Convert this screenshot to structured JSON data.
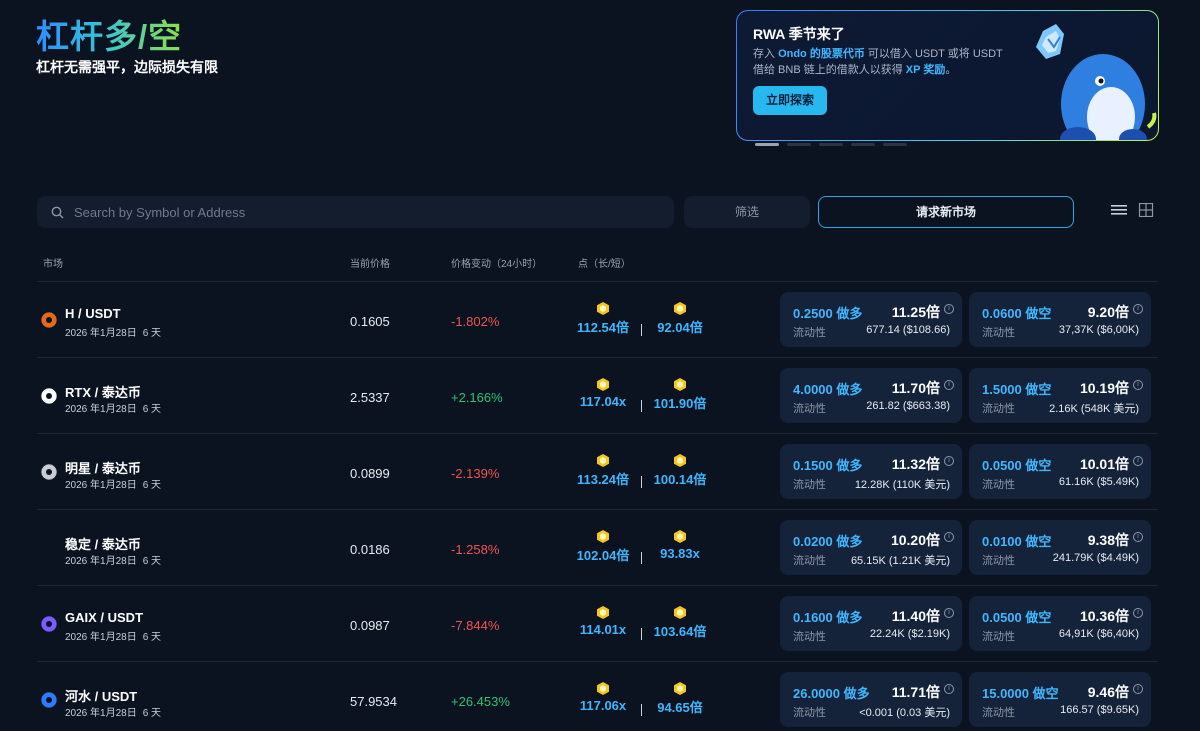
{
  "hero": {
    "title": "杠杆多/空",
    "subtitle": "杠杆无需强平，边际损失有限"
  },
  "promo": {
    "title": "RWA 季节来了",
    "line1_a": "存入 ",
    "line1_hl": "Ondo 的股票代币",
    "line1_b": " 可以借入 USDT 或将 USDT",
    "line2_a": "借给 BNB 链上的借款人以获得 ",
    "line2_hl": "XP 奖励",
    "line2_b": "。",
    "button": "立即探索"
  },
  "toolbar": {
    "search_placeholder": "Search by Symbol or Address",
    "filter": "筛选",
    "request": "请求新市场"
  },
  "table": {
    "headers": {
      "market": "市场",
      "price": "当前价格",
      "change": "价格变动（24小时）",
      "points": "点（长/短）"
    },
    "liq_label": "流动性",
    "days": "6 天",
    "rows": [
      {
        "pair": "H / USDT",
        "date": "2026 年1月28日",
        "price": "0.1605",
        "change": "-1.802%",
        "dir": "neg",
        "pts_long": "112.54倍",
        "pts_short": "92.04倍",
        "long": {
          "rate": "0.2500 做多",
          "lev": "11.25倍",
          "liq": "677.14 ($108.66)"
        },
        "short": {
          "rate": "0.0600 做空",
          "lev": "9.20倍",
          "liq": "37,37K ($6,00K)"
        },
        "icon_color": "#e36a1c"
      },
      {
        "pair": "RTX / 泰达币",
        "date": "2026 年1月28日",
        "price": "2.5337",
        "change": "+2.166%",
        "dir": "pos",
        "pts_long": "117.04x",
        "pts_short": "101.90倍",
        "long": {
          "rate": "4.0000 做多",
          "lev": "11.70倍",
          "liq": "261.82 ($663.38)"
        },
        "short": {
          "rate": "1.5000 做空",
          "lev": "10.19倍",
          "liq": "2.16K (548K 美元)"
        },
        "icon_color": "#ffffff"
      },
      {
        "pair": "明星 / 泰达币",
        "date": "2026 年1月28日",
        "price": "0.0899",
        "change": "-2.139%",
        "dir": "neg",
        "pts_long": "113.24倍",
        "pts_short": "100.14倍",
        "long": {
          "rate": "0.1500 做多",
          "lev": "11.32倍",
          "liq": "12.28K (110K 美元)"
        },
        "short": {
          "rate": "0.0500 做空",
          "lev": "10.01倍",
          "liq": "61.16K ($5.49K)"
        },
        "icon_color": "#c9ccd2"
      },
      {
        "pair": "稳定 / 泰达币",
        "date": "2026 年1月28日",
        "price": "0.0186",
        "change": "-1.258%",
        "dir": "neg",
        "pts_long": "102.04倍",
        "pts_short": "93.83x",
        "long": {
          "rate": "0.0200 做多",
          "lev": "10.20倍",
          "liq": "65.15K (1.21K 美元)"
        },
        "short": {
          "rate": "0.0100 做空",
          "lev": "9.38倍",
          "liq": "241.79K ($4.49K)"
        },
        "icon_color": "#0b1220"
      },
      {
        "pair": "GAIX / USDT",
        "date": "2026 年1月28日",
        "price": "0.0987",
        "change": "-7.844%",
        "dir": "neg",
        "pts_long": "114.01x",
        "pts_short": "103.64倍",
        "long": {
          "rate": "0.1600 做多",
          "lev": "11.40倍",
          "liq": "22.24K ($2.19K)"
        },
        "short": {
          "rate": "0.0500 做空",
          "lev": "10.36倍",
          "liq": "64,91K ($6,40K)"
        },
        "icon_color": "#7b5cff"
      },
      {
        "pair": "河水 / USDT",
        "date": "2026 年1月28日",
        "price": "57.9534",
        "change": "+26.453%",
        "dir": "pos",
        "pts_long": "117.06x",
        "pts_short": "94.65倍",
        "long": {
          "rate": "26.0000 做多",
          "lev": "11.71倍",
          "liq": "<0.001 (0.03 美元)"
        },
        "short": {
          "rate": "15.0000 做空",
          "lev": "9.46倍",
          "liq": "166.57 ($9.65K)"
        },
        "icon_color": "#2d7bff"
      }
    ]
  },
  "colors": {
    "accent": "#3fb7ff",
    "negative": "#f0554f",
    "positive": "#34c36c",
    "background": "#0b1220",
    "card": "#15233a"
  }
}
